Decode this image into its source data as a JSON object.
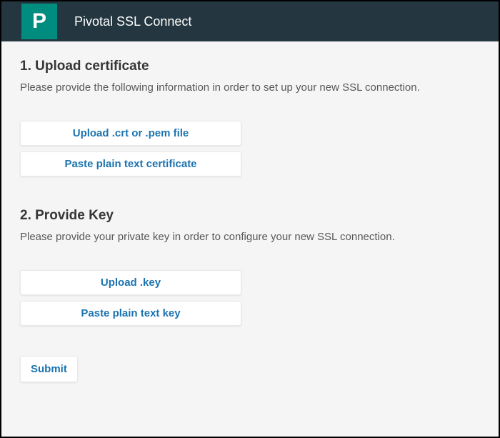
{
  "header": {
    "logo_letter": "P",
    "title": "Pivotal SSL Connect"
  },
  "section1": {
    "heading": "1. Upload certificate",
    "description": "Please provide the following information in order to set up your new SSL connection.",
    "button_upload": "Upload .crt or .pem file",
    "button_paste": "Paste plain text certificate"
  },
  "section2": {
    "heading": "2. Provide Key",
    "description": "Please provide your private key in order to configure your new SSL connection.",
    "button_upload": "Upload .key",
    "button_paste": "Paste plain text key"
  },
  "submit_label": "Submit"
}
